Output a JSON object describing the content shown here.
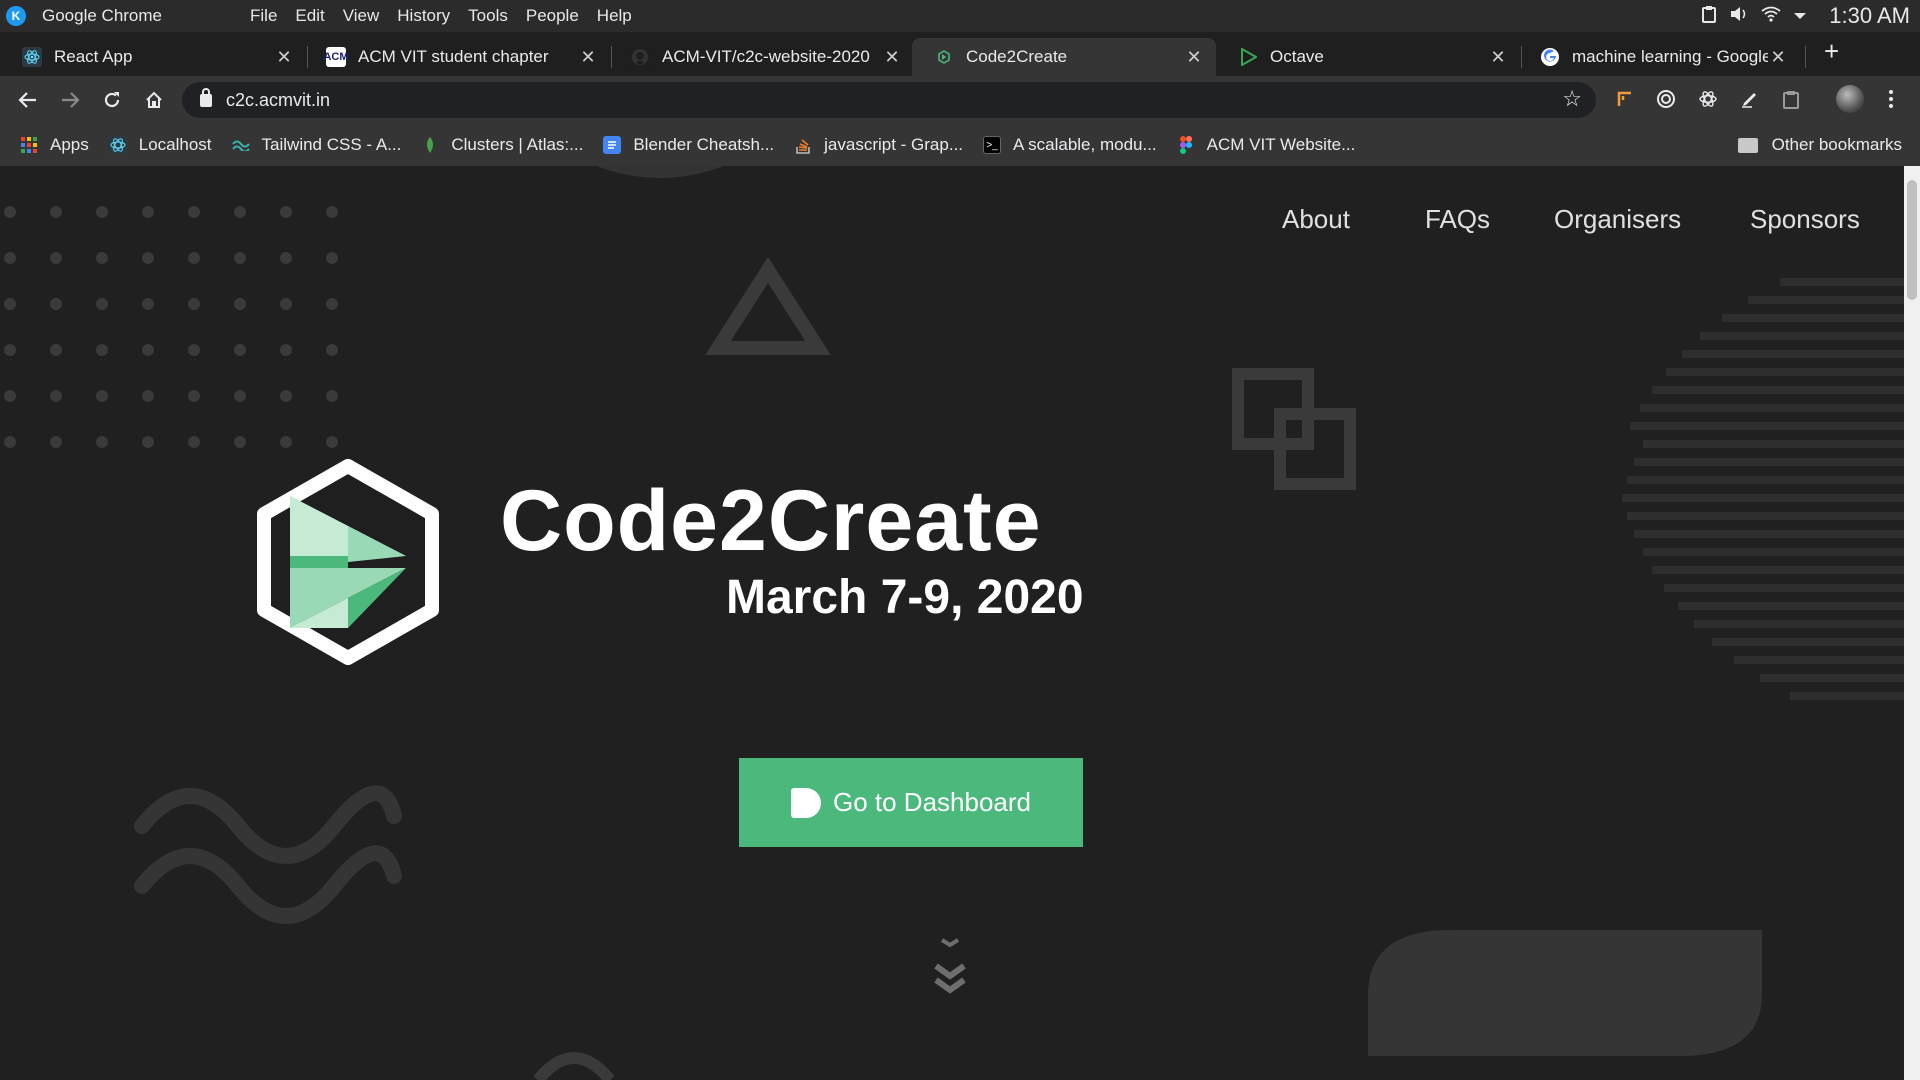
{
  "os": {
    "app_name": "Google Chrome",
    "menu": [
      "File",
      "Edit",
      "View",
      "History",
      "Tools",
      "People",
      "Help"
    ],
    "clock": "1:30 AM"
  },
  "tabs": [
    {
      "title": "React App",
      "favicon": "react-icon",
      "color": "#61dafb"
    },
    {
      "title": "ACM VIT student chapter",
      "favicon": "acm-icon",
      "color": "#ffffff"
    },
    {
      "title": "ACM-VIT/c2c-website-2020",
      "favicon": "github-icon",
      "color": "#333333"
    },
    {
      "title": "Code2Create",
      "favicon": "c2c-icon",
      "color": "#4bb87c"
    },
    {
      "title": "Octave",
      "favicon": "play-icon",
      "color": "#34a853"
    },
    {
      "title": "machine learning - Google",
      "favicon": "google-icon",
      "color": "#ffffff"
    }
  ],
  "active_tab": 3,
  "toolbar": {
    "url": "c2c.acmvit.in"
  },
  "bookmarks": [
    {
      "label": "Apps",
      "icon": "apps-grid-icon",
      "color": "#ea4335"
    },
    {
      "label": "Localhost",
      "icon": "react-icon",
      "color": "#61dafb"
    },
    {
      "label": "Tailwind CSS - A...",
      "icon": "tailwind-icon",
      "color": "#38b2ac"
    },
    {
      "label": "Clusters | Atlas:...",
      "icon": "mongodb-leaf-icon",
      "color": "#47a248"
    },
    {
      "label": "Blender Cheatsh...",
      "icon": "docs-icon",
      "color": "#4285f4"
    },
    {
      "label": "javascript - Grap...",
      "icon": "stackoverflow-icon",
      "color": "#f48024"
    },
    {
      "label": "A scalable, modu...",
      "icon": "terminal-icon",
      "color": "#000000"
    },
    {
      "label": "ACM VIT Website...",
      "icon": "figma-icon",
      "color": "#f24e1e"
    }
  ],
  "other_bookmarks": "Other bookmarks",
  "site": {
    "nav": [
      "About",
      "FAQs",
      "Organisers",
      "Sponsors"
    ],
    "title": "Code2Create",
    "date": "March 7-9, 2020",
    "cta": "Go to Dashboard",
    "accent": "#4bb87c"
  }
}
